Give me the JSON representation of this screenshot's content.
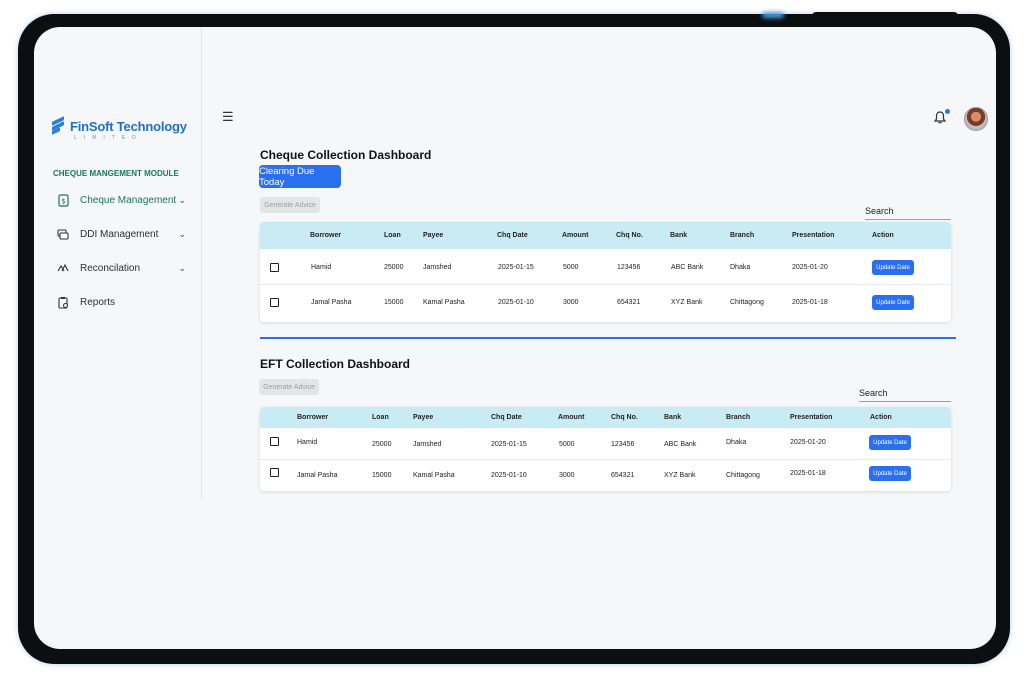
{
  "brand": {
    "name": "FinSoft Technology",
    "tagline": "LIMITED"
  },
  "sidebar": {
    "module_title": "CHEQUE MANGEMENT MODULE",
    "items": [
      {
        "label": "Cheque Management",
        "icon": "cheque-doc-icon",
        "expandable": true,
        "active": true
      },
      {
        "label": "DDI Management",
        "icon": "ddi-icon",
        "expandable": true
      },
      {
        "label": "Reconcilation",
        "icon": "reconcile-icon",
        "expandable": true
      },
      {
        "label": "Reports",
        "icon": "reports-icon",
        "expandable": false
      }
    ]
  },
  "header": {
    "menu_icon": "hamburger-icon",
    "notification_icon": "bell-icon",
    "avatar": "user-avatar"
  },
  "cheque_dashboard": {
    "title": "Cheque Collection Dashboard",
    "primary_button": "Clearing Due Today",
    "generate_button": "Generate Advice",
    "search_label": "Search",
    "columns": [
      "Borrower",
      "Loan",
      "Payee",
      "Chq Date",
      "Amount",
      "Chq No.",
      "Bank",
      "Branch",
      "Presentation",
      "Action"
    ],
    "rows": [
      [
        "Hamid",
        "25000",
        "Jamshed",
        "2025-01-15",
        "5000",
        "123456",
        "ABC Bank",
        "Dhaka",
        "2025-01-20",
        "Update Date"
      ],
      [
        "Jamal Pasha",
        "15000",
        "Kamal Pasha",
        "2025-01-10",
        "3000",
        "654321",
        "XYZ Bank",
        "Chittagong",
        "2025-01-18",
        "Update Date"
      ]
    ]
  },
  "eft_dashboard": {
    "title": "EFT Collection Dashboard",
    "generate_button": "Generate Advice",
    "search_label": "Search",
    "columns": [
      "Borrower",
      "Loan",
      "Payee",
      "Chq Date",
      "Amount",
      "Chq No.",
      "Bank",
      "Branch",
      "Presentation",
      "Action"
    ],
    "rows": [
      [
        "Hamid",
        "25000",
        "Jamshed",
        "2025-01-15",
        "5000",
        "123456",
        "ABC Bank",
        "Dhaka",
        "2025-01-20",
        "Update Date"
      ],
      [
        "Jamal Pasha",
        "15000",
        "Kamal Pasha",
        "2025-01-10",
        "3000",
        "654321",
        "XYZ Bank",
        "Chittagong",
        "2025-01-18",
        "Update Date"
      ]
    ]
  },
  "colors": {
    "primary": "#2a6ff0",
    "accent_green": "#157a56",
    "table_header": "#c9ecf4",
    "brand_blue": "#1f6fd0"
  }
}
